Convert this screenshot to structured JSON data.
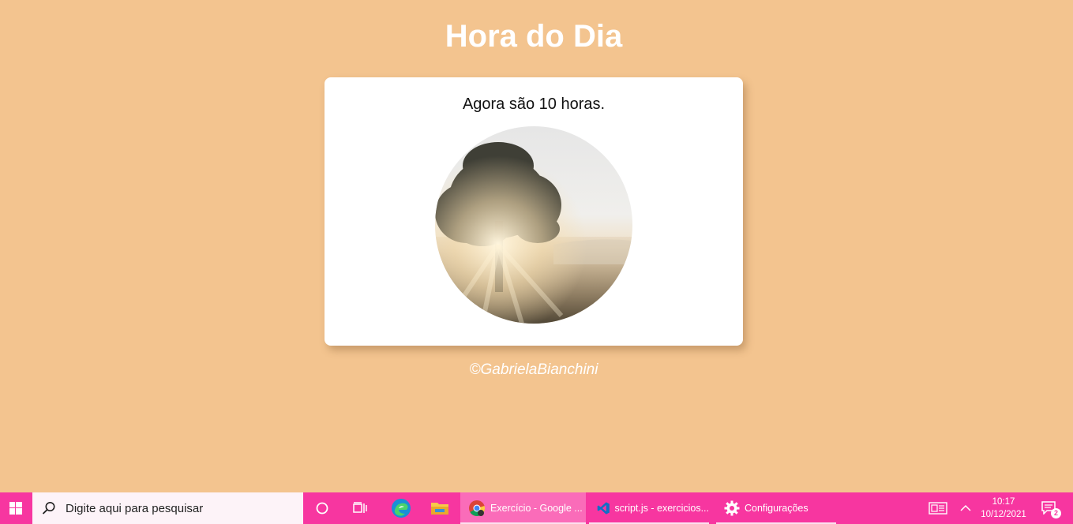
{
  "page": {
    "title": "Hora do Dia",
    "hour_message": "Agora são 10 horas.",
    "image_alt_icon": "morning-tree-photo",
    "footer": "©GabrielaBianchini"
  },
  "colors": {
    "background": "#f3c48f",
    "card": "#ffffff",
    "taskbar": "#f736a0"
  },
  "taskbar": {
    "search_placeholder": "Digite aqui para pesquisar",
    "apps": [
      {
        "label": "Exercício - Google ...",
        "icon": "chrome-icon"
      },
      {
        "label": "script.js - exercicios...",
        "icon": "vscode-icon"
      },
      {
        "label": "Configurações",
        "icon": "gear-icon"
      }
    ],
    "time": "10:17",
    "date": "10/12/2021",
    "notification_count": "2"
  }
}
